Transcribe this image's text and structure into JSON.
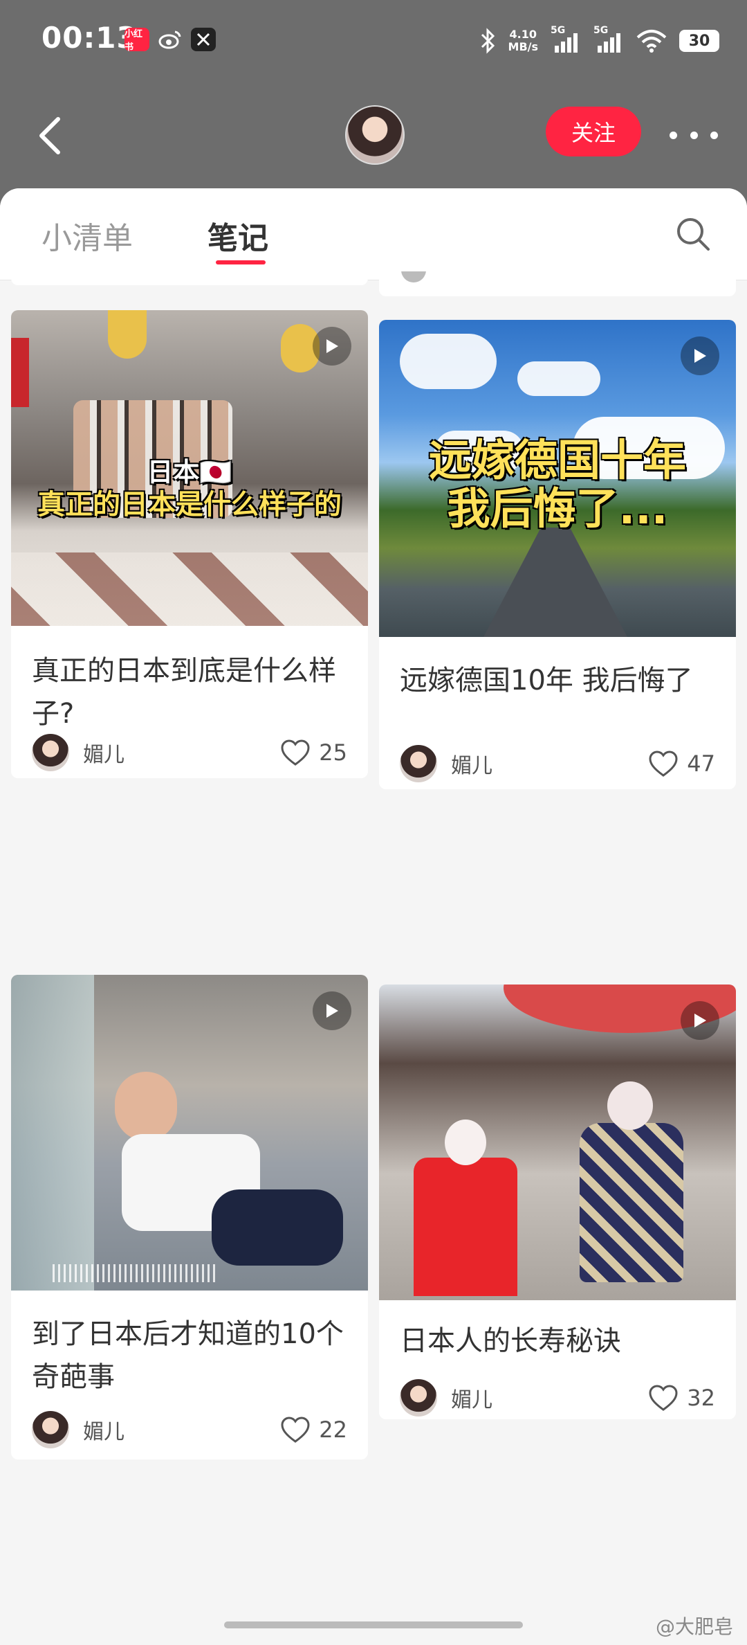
{
  "status_bar": {
    "time": "00:13",
    "apps": [
      "小红书",
      "weibo",
      "x"
    ],
    "net_speed_value": "4.10",
    "net_speed_unit": "MB/s",
    "signal_label": "5G",
    "battery": "30"
  },
  "header": {
    "follow_label": "关注"
  },
  "tabs": [
    {
      "label": "小清单",
      "active": false
    },
    {
      "label": "笔记",
      "active": true
    }
  ],
  "cards": [
    {
      "overlay_line1": "日本🇯🇵",
      "overlay_line2": "真正的日本是什么样子的",
      "title": "真正的日本到底是什么样子?",
      "author": "媚儿",
      "likes": "25"
    },
    {
      "overlay_line1": "远嫁德国十年",
      "overlay_line2": "我后悔了...",
      "title": "远嫁德国10年 我后悔了",
      "author": "媚儿",
      "likes": "47"
    },
    {
      "title": "到了日本后才知道的10个奇葩事",
      "author": "媚儿",
      "likes": "22"
    },
    {
      "title": "日本人的长寿秘诀",
      "author": "媚儿",
      "likes": "32"
    }
  ],
  "watermark": "@大肥皂"
}
